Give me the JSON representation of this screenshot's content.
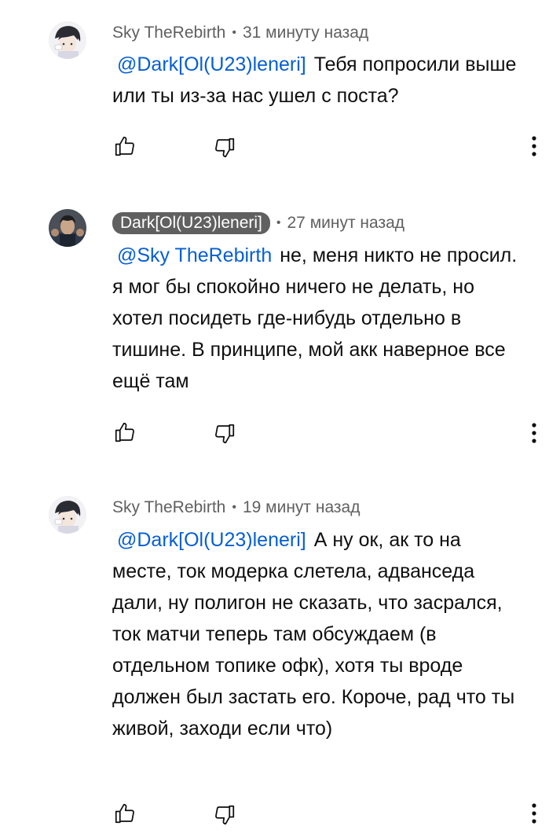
{
  "comments": [
    {
      "author": "Sky TheRebirth",
      "time": "31 минуту назад",
      "mention": "@Dark[Ol(U23)leneri]",
      "body": "Тебя попросили выше или ты из-за нас ушел с поста?",
      "avatar_icon": "anime-avatar-icon"
    },
    {
      "author": "Dark[Ol(U23)leneri]",
      "time": "27 минут назад",
      "mention": "@Sky TheRebirth",
      "body": "не, меня никто не просил. я мог бы спокойно ничего не делать, но хотел посидеть где-нибудь отдельно в тишине. В принципе, мой акк наверное все ещё там",
      "avatar_icon": "group-photo-avatar-icon",
      "is_channel_author": true
    },
    {
      "author": "Sky TheRebirth",
      "time": "19 минут назад",
      "mention": "@Dark[Ol(U23)leneri]",
      "body": "А ну ок, ак то на месте, ток модерка слетела, адванседа дали, ну полигон не сказать, что засрался, ток матчи теперь там обсуждаем (в отдельном топике офк), хотя ты вроде должен был застать его. Короче, рад что ты живой, заходи если что)",
      "avatar_icon": "anime-avatar-icon"
    }
  ],
  "separator": "•",
  "icons": {
    "like": "thumbs-up-icon",
    "dislike": "thumbs-down-icon",
    "menu": "more-vert-icon"
  }
}
